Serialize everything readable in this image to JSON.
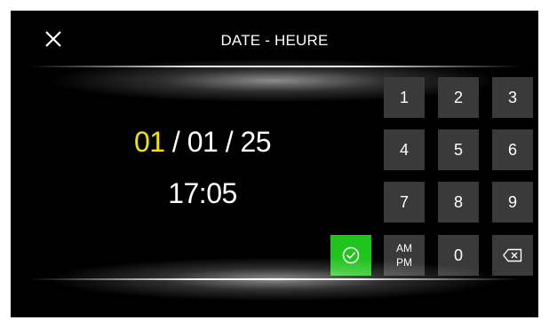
{
  "header": {
    "title": "DATE - HEURE",
    "close_icon": "close-icon"
  },
  "display": {
    "date_day": "01",
    "date_rest": " / 01 / 25",
    "time": "17:05",
    "active_color": "#f2e400"
  },
  "keypad": {
    "keys": [
      "1",
      "2",
      "3",
      "4",
      "5",
      "6",
      "7",
      "8",
      "9"
    ],
    "am_label": "AM",
    "pm_label": "PM",
    "zero": "0",
    "backspace_icon": "backspace-icon",
    "confirm_icon": "check-circle-icon",
    "confirm_color": "#20c41c",
    "key_color": "#3a3a3a"
  }
}
